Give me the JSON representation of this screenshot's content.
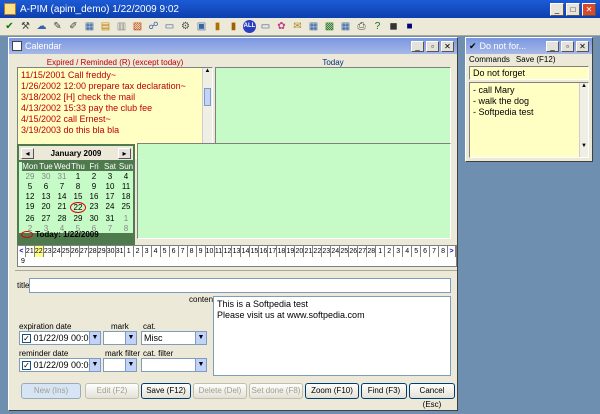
{
  "app": {
    "title": "A-PIM  (apim_demo) 1/22/2009 9:02"
  },
  "toolbar_icons": [
    "check-icon",
    "wrench-icon",
    "cloud-icon",
    "paperclip-icon",
    "pen-icon",
    "calendar-icon",
    "note-icon",
    "notes-icon",
    "chart-icon",
    "network-icon",
    "window-icon",
    "gear-icon",
    "disk-icon",
    "book-icon",
    "book-icon",
    "all-icon",
    "window-icon",
    "palette-icon",
    "envelope-icon",
    "calendar-icon",
    "grid-icon",
    "calendar-icon",
    "print-icon",
    "help-icon",
    "box-icon",
    "terminal-icon"
  ],
  "toolbar_all_label": "ALL",
  "calendar": {
    "title": "Calendar",
    "expired_header": "Expired / Reminded (R) (except today)",
    "today_header": "Today",
    "expired_items": [
      "11/15/2001 Call freddy~",
      "1/26/2002 12:00 prepare tax declaration~",
      "3/18/2002 [H] check the mail",
      "4/13/2002 15:33 pay the club fee",
      "4/15/2002 call Ernest~",
      "3/19/2003 do this bla bla"
    ],
    "month_label": "January 2009",
    "day_names": [
      "Mon",
      "Tue",
      "Wed",
      "Thu",
      "Fri",
      "Sat",
      "Sun"
    ],
    "weeks": [
      [
        "29",
        "30",
        "31",
        "1",
        "2",
        "3",
        "4"
      ],
      [
        "5",
        "6",
        "7",
        "8",
        "9",
        "10",
        "11"
      ],
      [
        "12",
        "13",
        "14",
        "15",
        "16",
        "17",
        "18"
      ],
      [
        "19",
        "20",
        "21",
        "22",
        "23",
        "24",
        "25"
      ],
      [
        "26",
        "27",
        "28",
        "29",
        "30",
        "31",
        "1"
      ],
      [
        "2",
        "3",
        "4",
        "5",
        "6",
        "7",
        "8"
      ]
    ],
    "today_label": "Today: 1/22/2009",
    "strip_days": [
      "21",
      "22",
      "23",
      "24",
      "25",
      "26",
      "27",
      "28",
      "29",
      "30",
      "31",
      "1",
      "2",
      "3",
      "4",
      "5",
      "6",
      "7",
      "8",
      "9",
      "10",
      "11",
      "12",
      "13",
      "14",
      "15",
      "16",
      "17",
      "18",
      "19",
      "20",
      "21",
      "22",
      "23",
      "24",
      "25",
      "26",
      "27",
      "28",
      "1",
      "2",
      "3",
      "4",
      "5",
      "6",
      "7",
      "8"
    ],
    "strip_nav_left": "<",
    "strip_nav_right": ">",
    "strip_below": "9",
    "title_label": "title",
    "content_label": "content",
    "content_lines": [
      "This is a Softpedia test",
      "Please visit us at www.softpedia.com"
    ],
    "expiration_label": "expiration date",
    "expiration_value": "01/22/09 00:00",
    "reminder_label": "reminder date",
    "reminder_value": "01/22/09 00:00",
    "mark_label": "mark",
    "mark_filter_label": "mark filter",
    "cat_label": "cat.",
    "cat_value": "Misc",
    "cat_filter_label": "cat. filter",
    "buttons": {
      "new": "New (Ins)",
      "edit": "Edit (F2)",
      "save": "Save (F12)",
      "delete": "Delete (Del)",
      "set_done": "Set done (F8)",
      "zoom": "Zoom (F10)",
      "find": "Find (F3)",
      "cancel": "Cancel (Esc)"
    }
  },
  "note": {
    "title": "Do not for...",
    "menu_commands": "Commands",
    "menu_save": "Save (F12)",
    "heading": "Do not forget",
    "items": [
      "- call Mary",
      "- walk the dog",
      "- Softpedia test"
    ]
  }
}
